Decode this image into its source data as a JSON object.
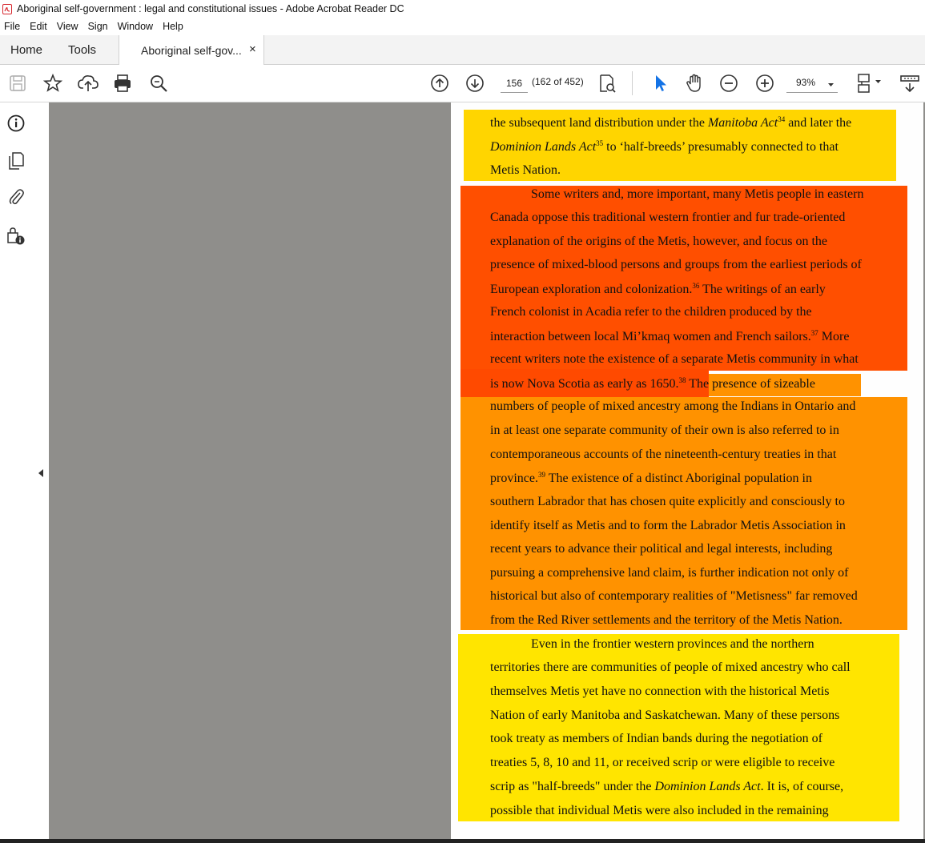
{
  "window": {
    "title": "Aboriginal self-government : legal and constitutional issues - Adobe Acrobat Reader DC"
  },
  "menu": [
    "File",
    "Edit",
    "View",
    "Sign",
    "Window",
    "Help"
  ],
  "tabs": {
    "home": "Home",
    "tools": "Tools",
    "document": "Aboriginal self-gov...",
    "close": "×"
  },
  "toolbar": {
    "page_number": "156",
    "page_count": "(162 of 452)",
    "zoom": "93%"
  },
  "icons": [
    "save-icon",
    "bookmark-star-icon",
    "upload-icon",
    "print-icon",
    "search-zoom-icon",
    "page-up-icon",
    "page-down-icon",
    "find-page-icon",
    "select-cursor-icon",
    "hand-icon",
    "zoom-out-icon",
    "zoom-in-icon",
    "fit-page-icon",
    "read-mode-icon",
    "info-icon",
    "pages-icon",
    "attachment-icon",
    "lock-info-icon",
    "collapse-arrow-icon"
  ],
  "colors": {
    "highlight_yellow": "#ffe500",
    "highlight_gold": "#ffd500",
    "highlight_orange": "#ff9200",
    "highlight_red_orange": "#ff4f00",
    "viewer_bg": "#8f8e8b",
    "accent_blue": "#1473e6"
  },
  "document": {
    "lines": [
      [
        "the subsequent land distribution under the ",
        "Manitoba Act",
        "34",
        " and later the"
      ],
      [
        "Dominion Lands Act",
        "35",
        " to ‘half-breeds’ presumably connected to that"
      ],
      [
        "Metis Nation."
      ],
      [
        "Some writers and, more important, many Metis people in eastern"
      ],
      [
        "Canada oppose this traditional western frontier and fur trade-oriented"
      ],
      [
        "explanation of the origins of the Metis, however, and focus on the"
      ],
      [
        "presence of mixed-blood persons and groups from the earliest periods of"
      ],
      [
        "European exploration and colonization.",
        "36",
        " The writings of an early"
      ],
      [
        "French colonist in Acadia refer to the children produced by the"
      ],
      [
        "interaction between local Mi’kmaq women and French sailors.",
        "37",
        " More"
      ],
      [
        "recent writers note the existence of a separate Metis community in what"
      ],
      [
        "is now Nova Scotia as early as 1650.",
        "38",
        " The presence of sizeable"
      ],
      [
        "numbers of people of mixed ancestry among the Indians in Ontario and"
      ],
      [
        "in at least one separate community of their own is also referred to in"
      ],
      [
        "contemporaneous accounts of the nineteenth-century treaties in that"
      ],
      [
        "province.",
        "39",
        " The existence of a distinct Aboriginal population in"
      ],
      [
        "southern Labrador that has chosen quite explicitly and consciously to"
      ],
      [
        "identify itself as Metis and to form the Labrador Metis Association in"
      ],
      [
        "recent years to advance their political and legal interests, including"
      ],
      [
        "pursuing a comprehensive land claim, is further indication not only of"
      ],
      [
        "historical but also of contemporary realities of \"Metisness\" far removed"
      ],
      [
        "from the Red River settlements and the territory of the Metis Nation."
      ],
      [
        "Even in the frontier western provinces and the northern"
      ],
      [
        "territories there are communities of people of mixed ancestry who call"
      ],
      [
        "themselves Metis yet have no connection with the historical Metis"
      ],
      [
        "Nation of early Manitoba and Saskatchewan. Many of these persons"
      ],
      [
        "took treaty as members of Indian bands during the negotiation of"
      ],
      [
        "treaties 5, 8, 10 and 11, or received scrip or were eligible to receive"
      ],
      [
        "scrip as \"half-breeds\" under the ",
        "Dominion Lands Act",
        ". It is, of course,"
      ],
      [
        "possible that individual Metis were also included in the remaining"
      ]
    ]
  }
}
